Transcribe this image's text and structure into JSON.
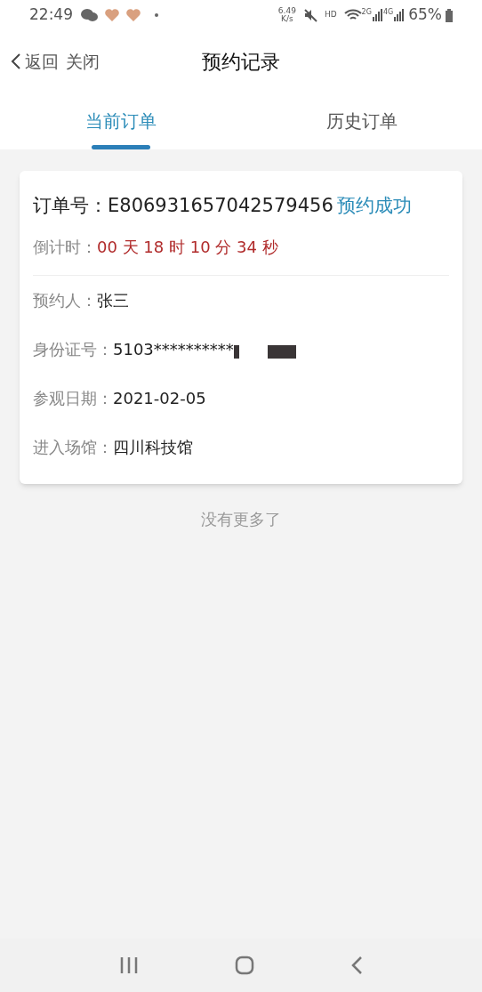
{
  "status_bar": {
    "time": "22:49",
    "speed": "6.49",
    "speed_unit": "K/s",
    "hd": "HD",
    "net_2g": "2G",
    "net_4g": "4G",
    "battery": "65%"
  },
  "header": {
    "back": "返回",
    "close": "关闭",
    "title": "预约记录"
  },
  "tabs": [
    {
      "label": "当前订单",
      "selected": true
    },
    {
      "label": "历史订单",
      "selected": false
    }
  ],
  "order": {
    "number_label": "订单号：",
    "number": "E806931657042579456",
    "status": "预约成功",
    "countdown_label": "倒计时：",
    "countdown": "00 天 18 时 10 分 34 秒",
    "fields": [
      {
        "label": "预约人：",
        "value": "张三"
      },
      {
        "label": "身份证号：",
        "value": "5103**********",
        "redacted": true
      },
      {
        "label": "参观日期：",
        "value": "2021-02-05"
      },
      {
        "label": "进入场馆：",
        "value": "四川科技馆"
      }
    ]
  },
  "footer_note": "没有更多了"
}
